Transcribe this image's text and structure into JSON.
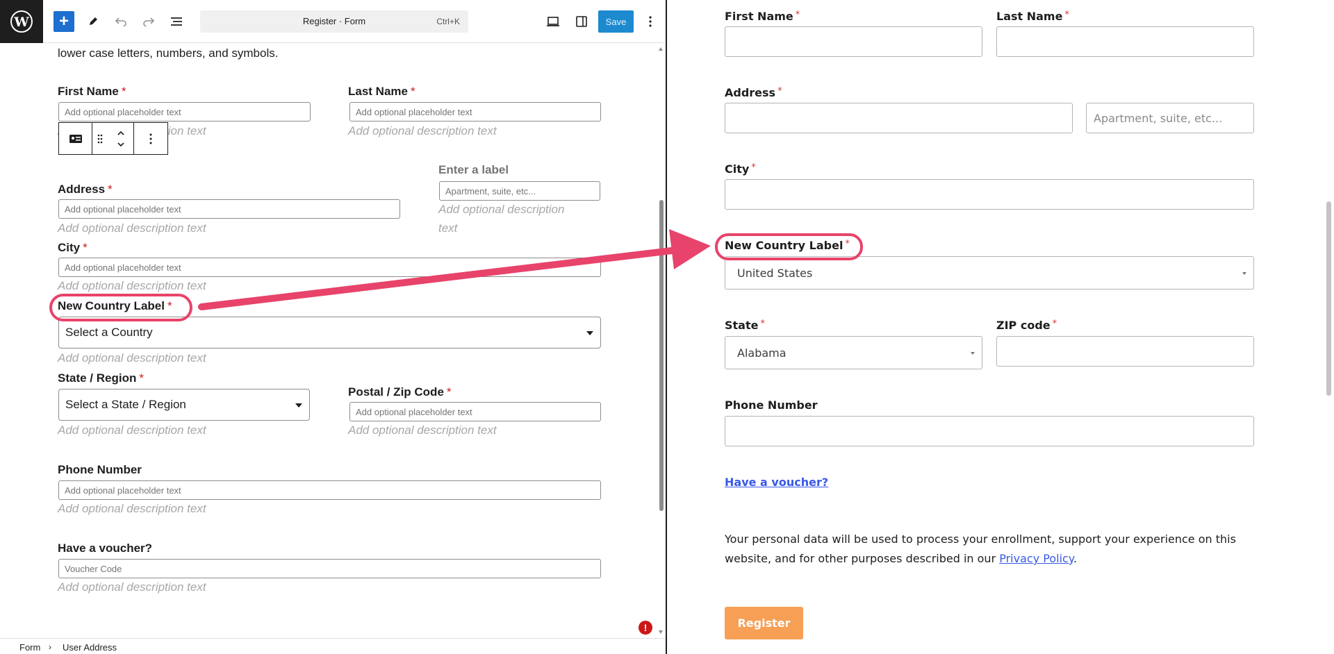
{
  "editor": {
    "topbar": {
      "add_icon": "plus-icon",
      "tools_icon": "pencil-icon",
      "undo_icon": "undo-icon",
      "redo_icon": "redo-icon",
      "outline_icon": "list-view-icon",
      "command_title": "Register · Form",
      "command_shortcut": "Ctrl+K",
      "view_icon": "desktop-icon",
      "settings_icon": "sidebar-icon",
      "save_label": "Save",
      "options_icon": "vertical-ellipsis-icon"
    },
    "intro_text": "lower case letters, numbers, and symbols.",
    "fields": {
      "first_name": {
        "label": "First Name",
        "placeholder": "Add optional placeholder text",
        "description": "Add optional description text"
      },
      "last_name": {
        "label": "Last Name",
        "placeholder": "Add optional placeholder text",
        "description": "Add optional description text"
      },
      "address": {
        "label": "Address",
        "placeholder": "Add optional placeholder text",
        "description": "Add optional description text"
      },
      "address2": {
        "label": "Enter a label",
        "placeholder": "Apartment, suite, etc...",
        "description_line1": "Add optional description",
        "description_line2": "text"
      },
      "city": {
        "label": "City",
        "placeholder": "Add optional placeholder text",
        "description": "Add optional description text"
      },
      "country": {
        "label": "New Country Label",
        "value": "Select a Country",
        "description": "Add optional description text"
      },
      "state": {
        "label": "State / Region",
        "value": "Select a State / Region",
        "description": "Add optional description text"
      },
      "postal": {
        "label": "Postal / Zip Code",
        "placeholder": "Add optional placeholder text",
        "description": "Add optional description text"
      },
      "phone": {
        "label": "Phone Number",
        "placeholder": "Add optional placeholder text",
        "description": "Add optional description text"
      },
      "voucher": {
        "label": "Have a voucher?",
        "placeholder": "Voucher Code",
        "description": "Add optional description text"
      }
    },
    "required_mark": "*",
    "breadcrumb": [
      "Form",
      "User Address"
    ]
  },
  "preview": {
    "fields": {
      "first_name": "First Name",
      "last_name": "Last Name",
      "address": "Address",
      "address2_placeholder": "Apartment, suite, etc...",
      "city": "City",
      "country_label": "New Country Label",
      "country_value": "United States",
      "state_label": "State",
      "state_value": "Alabama",
      "zip_label": "ZIP code",
      "phone_label": "Phone Number"
    },
    "required_mark": "*",
    "voucher_link": "Have a voucher?",
    "privacy_text_before": "Your personal data will be used to process your enrollment, support your experience on this website, and for other purposes described in our ",
    "privacy_link": "Privacy Policy",
    "privacy_text_after": ".",
    "register_label": "Register"
  },
  "colors": {
    "annotation": "#e8436a",
    "wp_blue": "#1d6fd0",
    "required": "#cc1818",
    "register_button": "#f79f55",
    "link": "#3858e9"
  }
}
